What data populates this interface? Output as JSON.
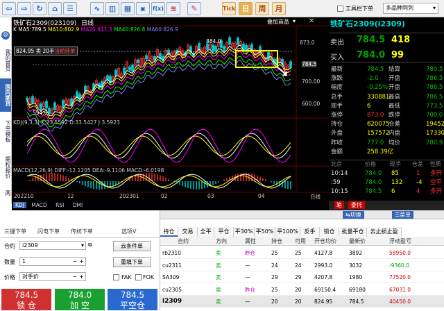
{
  "toolbar": {
    "icons": [
      "back-arrow-icon",
      "forward-arrow-icon",
      "refresh-icon",
      "home-icon",
      "list-icon",
      "chart-line-icon",
      "candlestick-icon",
      "fx-formula-icon",
      "indicator-icon",
      "tick-icon",
      "day-period",
      "week-period",
      "month-period"
    ],
    "tick_label": "Tick",
    "day_label": "日",
    "week_label": "周",
    "month_label": "月",
    "checkbox_label": "工具栏下单",
    "select_label": "多品种同列"
  },
  "sidebar": {
    "items": [
      "我的首页",
      "国内期货",
      "下单模板",
      "期权报价",
      "两"
    ],
    "active": 1
  },
  "chart": {
    "title": "铁矿石2309(023109)",
    "period": "日线",
    "overlay_label": "叠加商品",
    "ma_line": {
      "label": "K MA5:789.5",
      "ma10": "MA10:802.9",
      "ma20": "MA20:811.3",
      "ma40": "MA40:826.8",
      "ma60": "MA60:826.9"
    },
    "order_tag": "824.95 卖 20手",
    "order_tag_extra": "当前挂单",
    "y_labels": [
      "873.0",
      "784.5",
      "700.00",
      "600.00"
    ],
    "high_label": "884.0",
    "low_label": "554.0",
    "kdj_label": "KDJ(9,3,3) K:23.5592 D:33.5427 J:3.5923",
    "macd_label": "MACD(12,26,9) DIFF:-12.1205 DEA:-9.1106 MACD:-6.0198",
    "x_labels": [
      "202210",
      "12",
      "202301",
      "02",
      "03",
      "04"
    ],
    "x_end": "日线",
    "bottom_tabs": [
      "KDJ",
      "MACD",
      "RSI",
      "DMI"
    ],
    "colors": {
      "up": "#ff3030",
      "down": "#00c8c8",
      "ma5": "#ffffff",
      "ma10": "#ffff00",
      "ma20": "#ff00ff",
      "ma40": "#00ff00",
      "ma60": "#8080ff"
    }
  },
  "quote": {
    "title": "铁矿石2309(i2309)",
    "sell_label": "卖出",
    "sell_price": "784.5",
    "sell_vol": "418",
    "buy_label": "买入",
    "buy_price": "784.0",
    "buy_vol": "99",
    "rows": [
      [
        "最新",
        "784.5",
        "结算",
        "780.5"
      ],
      [
        "涨跌",
        "-2.0",
        "开盘",
        "786.5"
      ],
      [
        "幅度",
        "-0.25%",
        "开盘",
        "786.5"
      ],
      [
        "总手",
        "330881",
        "最高",
        "786.5"
      ],
      [
        "现手",
        "6",
        "最低",
        "773.5"
      ],
      [
        "涨停",
        "873.0",
        "跌停",
        "700.0"
      ],
      [
        "持仓",
        "620075",
        "仓差",
        "19452"
      ],
      [
        "外盘",
        "157572",
        "内盘",
        "173309"
      ],
      [
        "昨收",
        "777.0",
        "均价",
        "780.9"
      ],
      [
        "金额",
        "258.39亿",
        "",
        ""
      ]
    ],
    "ticks_header": [
      "北京",
      "价格",
      "现手",
      "仓差",
      "性质"
    ],
    "ticks": [
      [
        "10:14",
        "784.0",
        "85",
        "1",
        "多开"
      ],
      [
        ":59",
        "784.0",
        "132",
        "-4",
        "空平"
      ],
      [
        "10:15",
        "784.5",
        "6",
        "4",
        "多开"
      ]
    ],
    "tabs": [
      "笔",
      "委托"
    ]
  },
  "order": {
    "toolbar": [
      "切换",
      "菜单"
    ],
    "tabs": [
      "三键下单",
      "闪电下单",
      "传统下单",
      "选项V"
    ],
    "contract_label": "合约",
    "contract": "i2309",
    "qty_label": "数量",
    "qty": "1",
    "price_label": "价格",
    "price": "对手价",
    "cloud_btn": "云条件单",
    "reset_btn": "重填下单",
    "fak": "FAK",
    "fok": "FOK",
    "buy_price": "784.5",
    "buy_label": "锁 仓",
    "sell_price": "784.0",
    "sell_label": "加 空",
    "close_price": "784.5",
    "close_label": "平空仓"
  },
  "positions": {
    "tabs": [
      "持仓",
      "交易",
      "全平",
      "平仓",
      "平30%",
      "平50%",
      "平100%",
      "反手",
      "锁仓",
      "批量平仓",
      "云止损止盈"
    ],
    "headers": [
      "合约",
      "方向",
      "属性",
      "持仓",
      "可用",
      "开仓均价",
      "最新价",
      "浮动盈亏"
    ],
    "rows": [
      [
        "rb2310",
        "卖",
        "昨仓",
        "25",
        "25",
        "4127.8",
        "3892",
        "58950.0"
      ],
      [
        "cu2311",
        "卖",
        "—",
        "24",
        "24",
        "2993.0",
        "3032",
        "-9360.0"
      ],
      [
        "SA309",
        "卖",
        "—",
        "29",
        "29",
        "4207.8",
        "1980",
        "77520.0"
      ],
      [
        "cu2305",
        "卖",
        "昨仓",
        "25",
        "20",
        "69150.4",
        "69180",
        "67031.0"
      ],
      [
        "i2309",
        "卖",
        "—",
        "20",
        "20",
        "824.95",
        "784.5",
        "40450.0"
      ]
    ]
  }
}
